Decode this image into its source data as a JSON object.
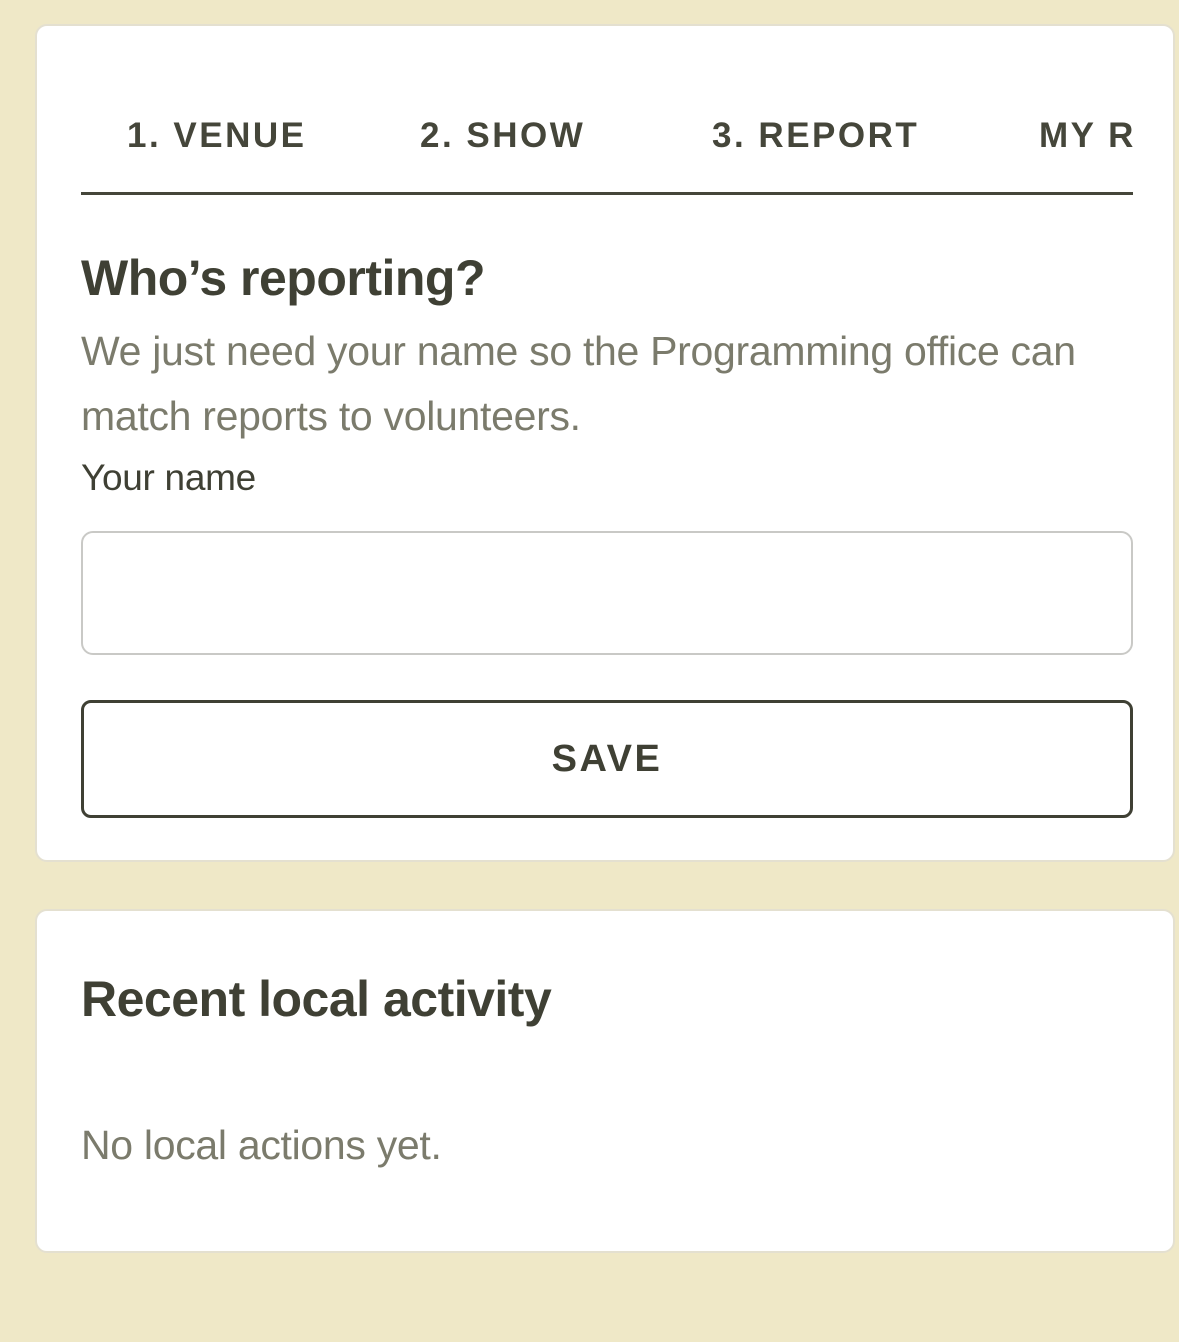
{
  "tabs": [
    {
      "label": "1. VENUE"
    },
    {
      "label": "2. SHOW"
    },
    {
      "label": "3. REPORT"
    },
    {
      "label": "MY R"
    }
  ],
  "reporter": {
    "heading": "Who’s reporting?",
    "description": "We just need your name so the Programming office can match reports to volunteers.",
    "name_label": "Your name",
    "name_value": "",
    "save_label": "SAVE"
  },
  "activity": {
    "heading": "Recent local activity",
    "empty_text": "No local actions yet."
  },
  "colors": {
    "page_background": "#efe8c7",
    "card_background": "#ffffff",
    "text_primary": "#3f4034",
    "text_muted": "#7b7b6c"
  }
}
